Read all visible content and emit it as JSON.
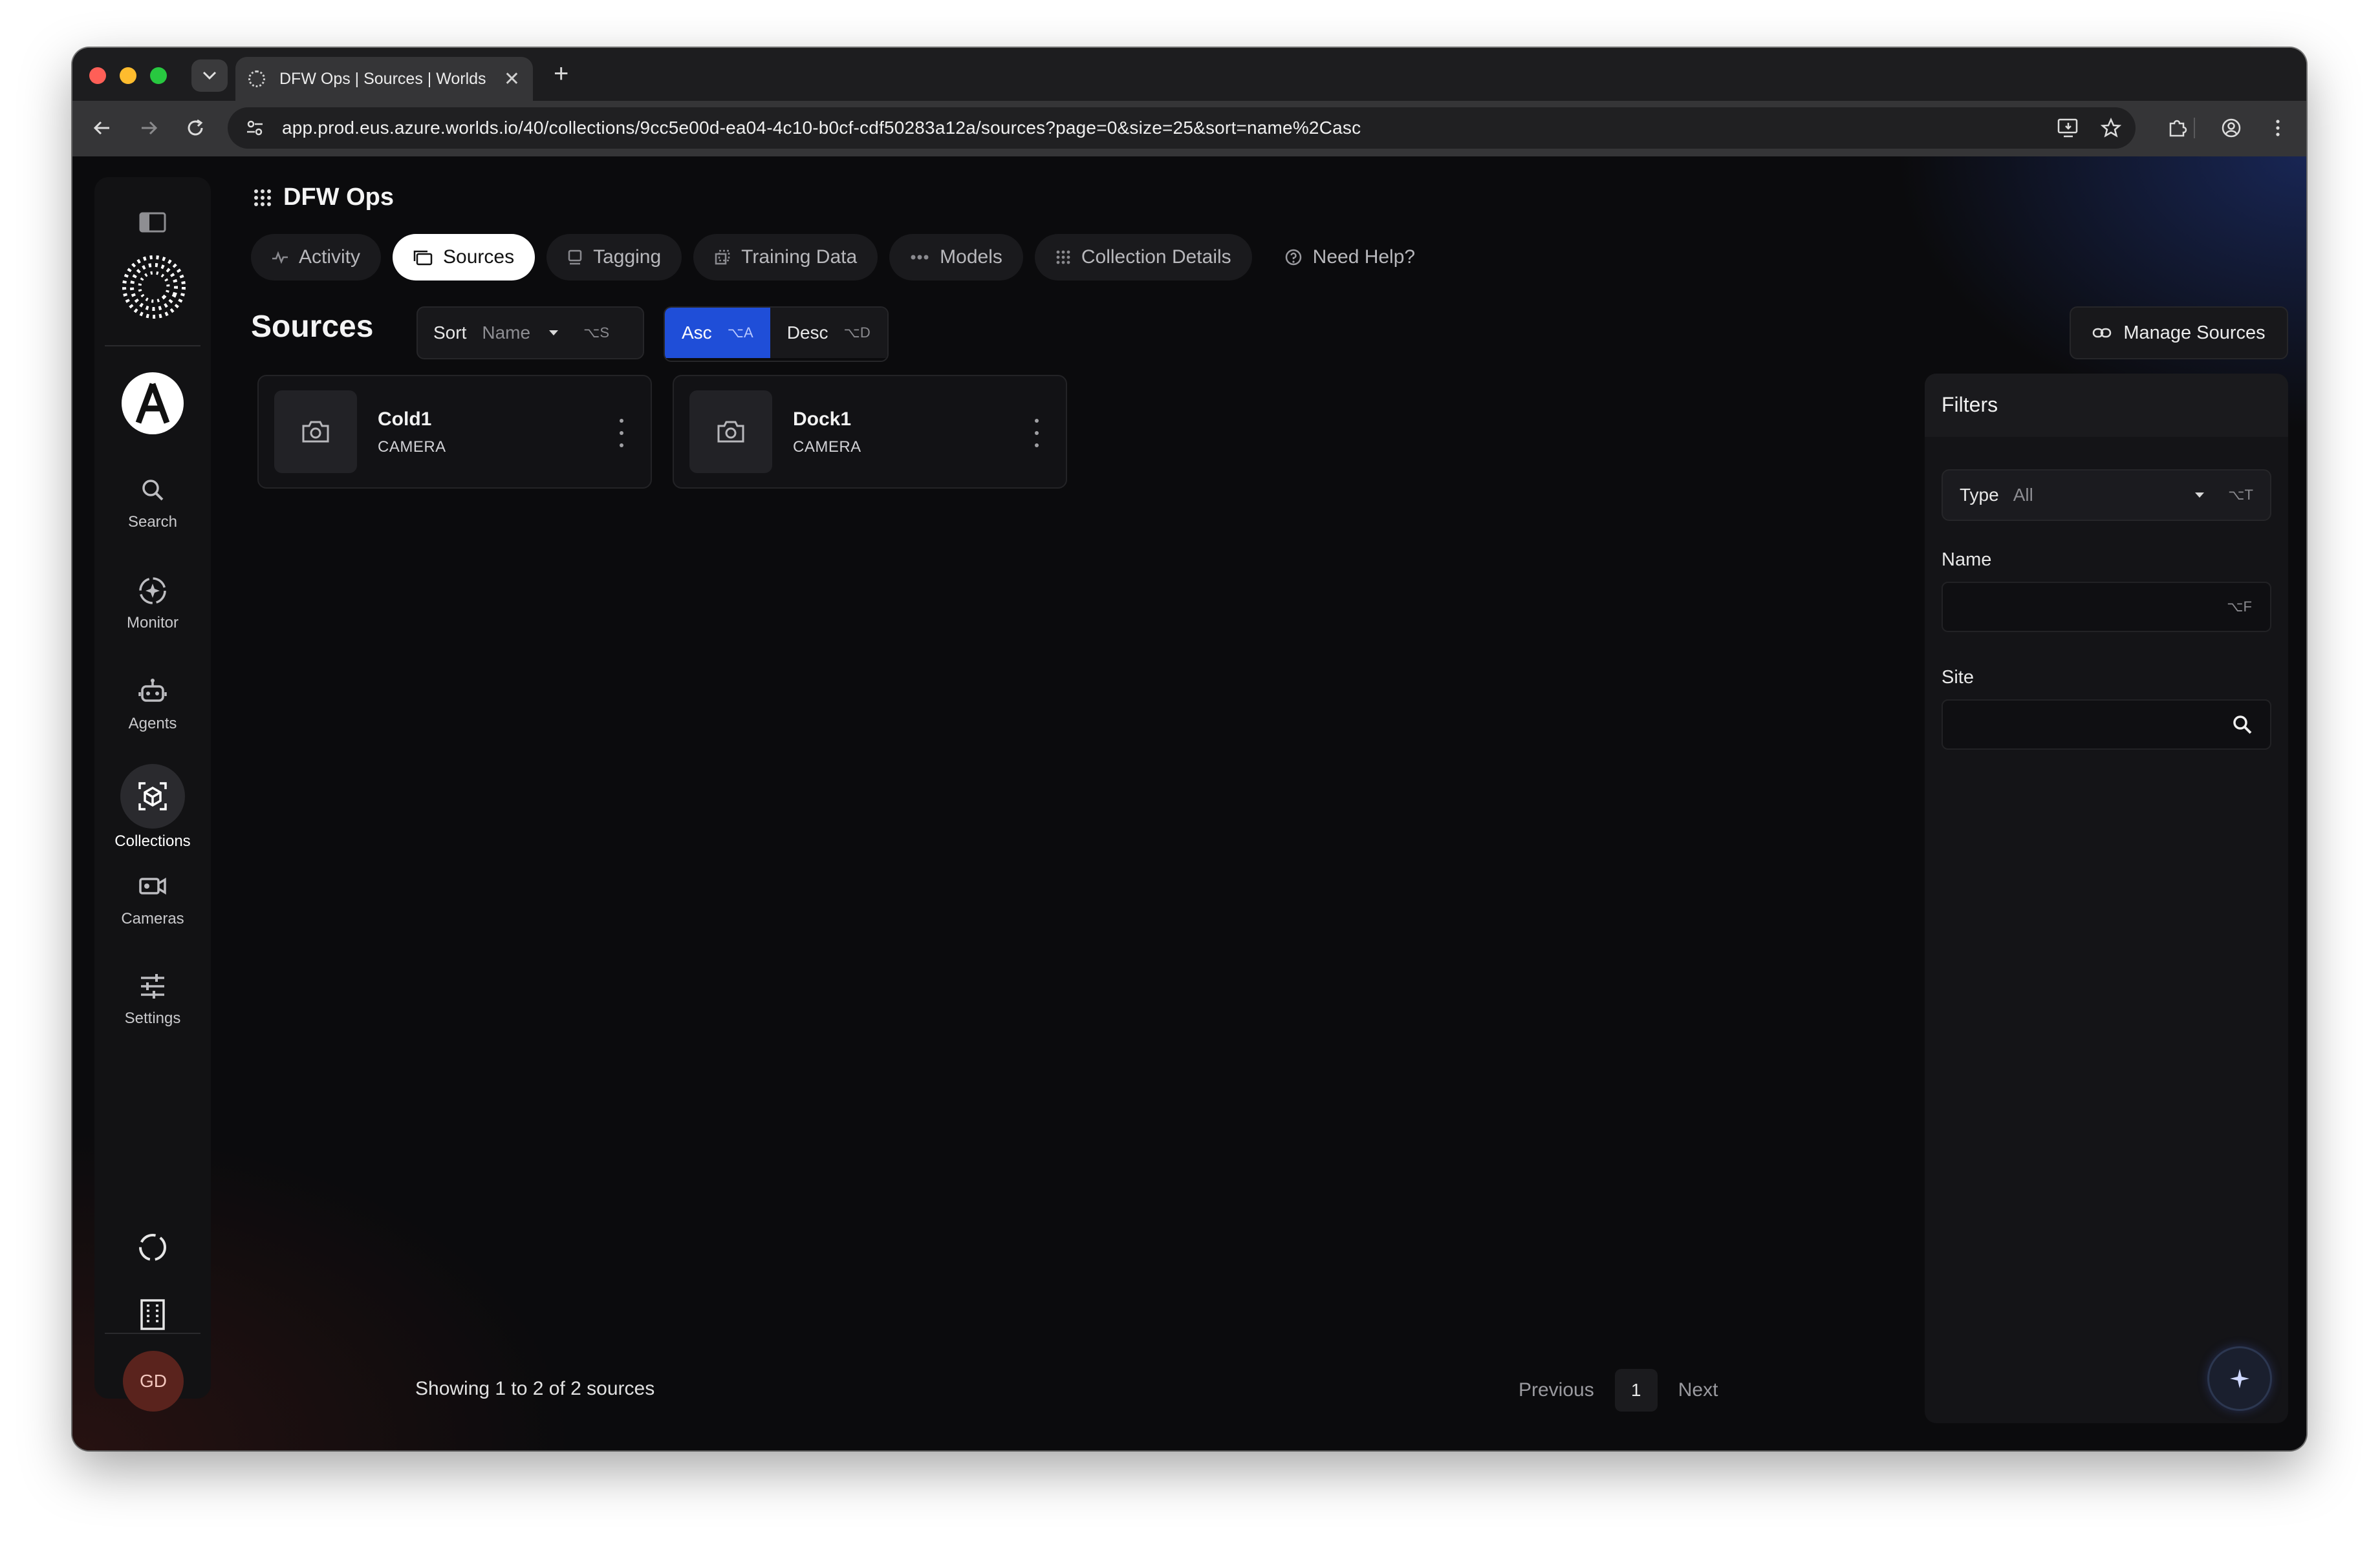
{
  "browser": {
    "tab_title": "DFW Ops | Sources | Worlds",
    "tab_close": "✕",
    "new_tab": "+",
    "url": "app.prod.eus.azure.worlds.io/40/collections/9cc5e00d-ea04-4c10-b0cf-cdf50283a12a/sources?page=0&size=25&sort=name%2Casc"
  },
  "sidebar": {
    "items": [
      {
        "label": "Search",
        "icon": "search-icon"
      },
      {
        "label": "Monitor",
        "icon": "monitor-icon"
      },
      {
        "label": "Agents",
        "icon": "robot-icon"
      },
      {
        "label": "Collections",
        "icon": "collections-icon",
        "active": true
      },
      {
        "label": "Cameras",
        "icon": "camera-icon"
      },
      {
        "label": "Settings",
        "icon": "sliders-icon"
      }
    ],
    "user_initials": "GD"
  },
  "header": {
    "title": "DFW Ops"
  },
  "tabs": [
    {
      "label": "Activity"
    },
    {
      "label": "Sources",
      "active": true
    },
    {
      "label": "Tagging"
    },
    {
      "label": "Training Data"
    },
    {
      "label": "Models"
    },
    {
      "label": "Collection Details"
    },
    {
      "label": "Need Help?"
    }
  ],
  "toolbar": {
    "page_title": "Sources",
    "sort_label": "Sort",
    "sort_value": "Name",
    "sort_shortcut": "⌥S",
    "asc_label": "Asc",
    "asc_shortcut": "⌥A",
    "desc_label": "Desc",
    "desc_shortcut": "⌥D",
    "manage_label": "Manage Sources"
  },
  "sources": [
    {
      "name": "Cold1",
      "type": "CAMERA"
    },
    {
      "name": "Dock1",
      "type": "CAMERA"
    }
  ],
  "footer": {
    "showing": "Showing 1 to 2 of 2 sources",
    "previous": "Previous",
    "page": "1",
    "next": "Next"
  },
  "filters": {
    "title": "Filters",
    "type_label": "Type",
    "type_value": "All",
    "type_shortcut": "⌥T",
    "name_label": "Name",
    "name_value": "",
    "name_shortcut": "⌥F",
    "site_label": "Site",
    "site_value": ""
  },
  "colors": {
    "accent": "#1f4ed8",
    "background": "#0b0b0d",
    "avatar": "#5a231d"
  }
}
